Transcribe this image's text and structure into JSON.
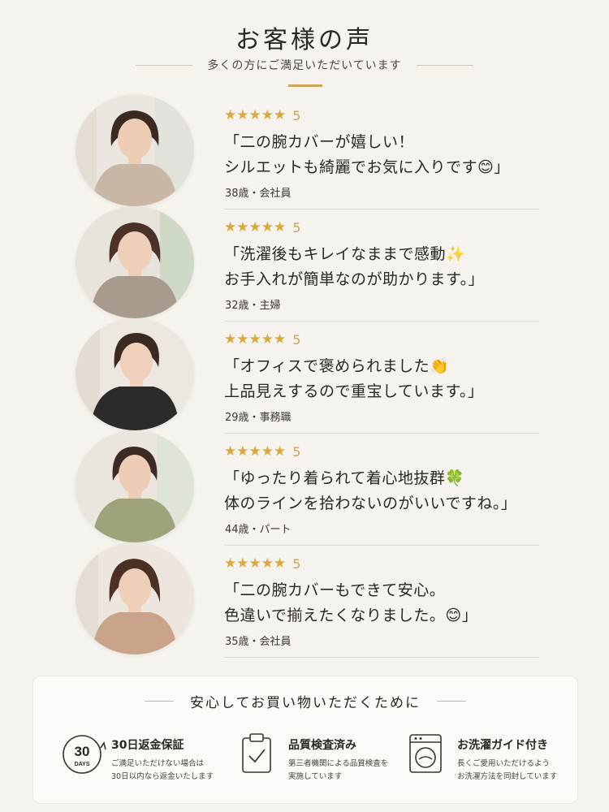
{
  "header": {
    "title": "お客様の声",
    "subtitle": "多くの方にご満足いただいています"
  },
  "colors": {
    "accent_gold": "#caa559",
    "star": "#d9a93a",
    "background": "#f6f3ee"
  },
  "reviews": [
    {
      "stars": "★★★★★",
      "rating": "5",
      "line1": "「二の腕カバーが嬉しい！",
      "line2": "シルエットも綺麗でお気に入りです😊」",
      "author": "38歳・会社員",
      "top_color": "#c8b7a4"
    },
    {
      "stars": "★★★★★",
      "rating": "5",
      "line1": "「洗濯後もキレイなままで感動✨",
      "line2": "お手入れが簡単なのが助かります。」",
      "author": "32歳・主婦",
      "top_color": "#a89a8c"
    },
    {
      "stars": "★★★★★",
      "rating": "5",
      "line1": "「オフィスで褒められました👏",
      "line2": "上品見えするので重宝しています。」",
      "author": "29歳・事務職",
      "top_color": "#2d2b29"
    },
    {
      "stars": "★★★★★",
      "rating": "5",
      "line1": "「ゆったり着られて着心地抜群🍀",
      "line2": "体のラインを拾わないのがいいですね。」",
      "author": "44歳・パート",
      "top_color": "#9fa37a"
    },
    {
      "stars": "★★★★★",
      "rating": "5",
      "line1": "「二の腕カバーもできて安心。",
      "line2": "  色違いで揃えたくなりました。😊」",
      "author": "35歳・会社員",
      "top_color": "#c9a48a"
    }
  ],
  "assurance": {
    "title": "安心してお買い物いただくために",
    "features": [
      {
        "icon": "30-days-badge-icon",
        "badge_number": "30",
        "badge_text": "DAYS",
        "title": "30日返金保証",
        "desc1": "ご満足いただけない場合は",
        "desc2": "30日以内なら返金いたします"
      },
      {
        "icon": "clipboard-check-icon",
        "title": "品質検査済み",
        "desc1": "第三者機関による品質検査を",
        "desc2": "実施しています"
      },
      {
        "icon": "washing-machine-icon",
        "title": "お洗濯ガイド付き",
        "desc1": "長くご愛用いただけるよう",
        "desc2": "お洗濯方法を同封しています"
      }
    ]
  }
}
